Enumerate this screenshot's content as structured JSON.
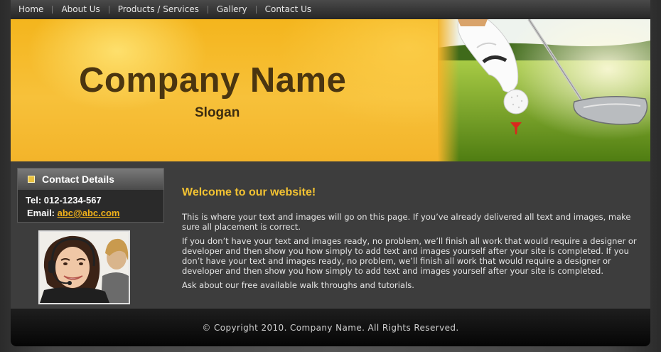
{
  "nav": {
    "items": [
      {
        "label": "Home"
      },
      {
        "label": "About Us"
      },
      {
        "label": "Products / Services"
      },
      {
        "label": "Gallery"
      },
      {
        "label": "Contact Us"
      }
    ]
  },
  "banner": {
    "company_name": "Company Name",
    "slogan": "Slogan",
    "image_icon": "golf-ball-on-tee-icon"
  },
  "sidebar": {
    "contact_title": "Contact Details",
    "tel": "Tel: 012-1234-567",
    "email_label": "Email:",
    "email": "abc@abc.com",
    "photo_icon": "support-agent-photo"
  },
  "content": {
    "heading": "Welcome to our website!",
    "paragraphs": [
      "This is where your text and images will go on this page. If you’ve already delivered all text and images, make sure all placement is correct.",
      "If you don’t have your text and images ready, no problem, we’ll finish all work that would require a designer or developer and then show you how simply to add text and images yourself after your site is completed. If you don’t have your text and images ready, no problem, we’ll finish all work that would require a designer or developer and then show you how simply to add text and images yourself after your site is completed.",
      "Ask about our free available walk throughs and tutorials."
    ]
  },
  "footer": {
    "copyright": "© Copyright 2010. Company Name. All Rights Reserved."
  },
  "colors": {
    "accent": "#f2c232",
    "banner": "#f4b51d",
    "background": "#3d3d3d"
  }
}
